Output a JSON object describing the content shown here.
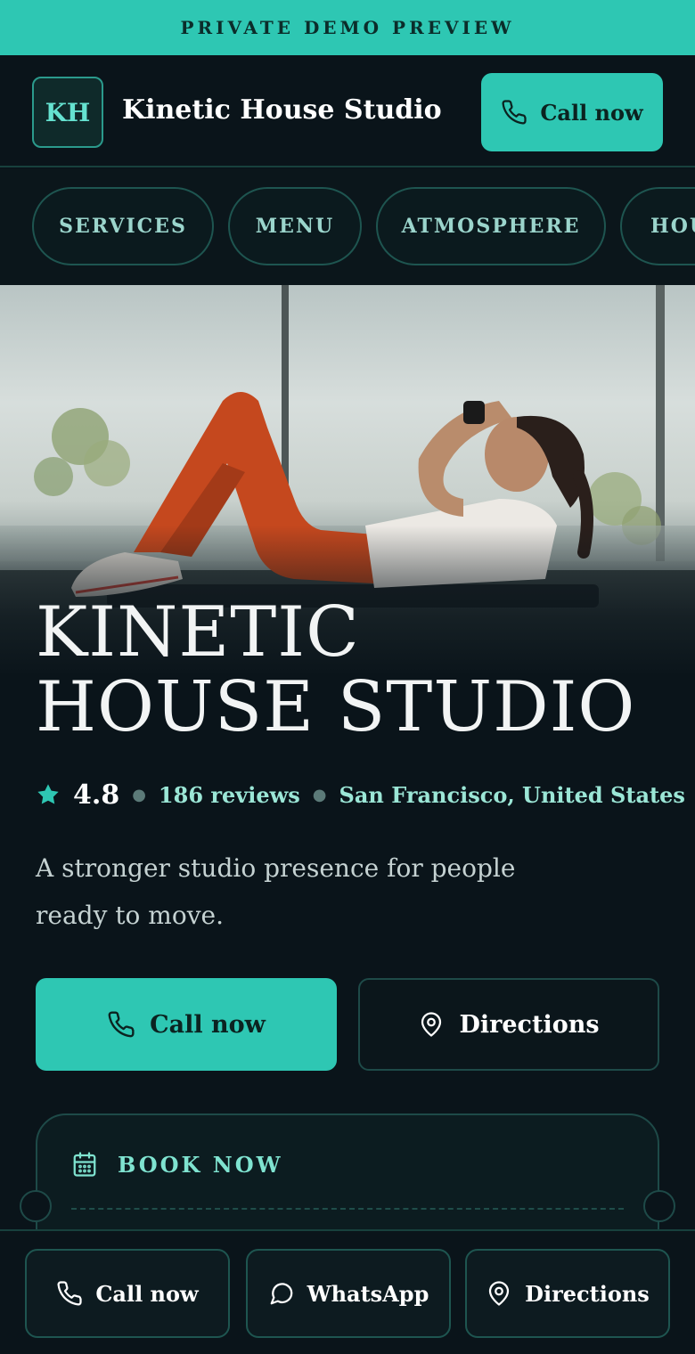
{
  "banner": {
    "text": "PRIVATE DEMO PREVIEW"
  },
  "header": {
    "logo_initials": "KH",
    "brand_name": "Kinetic House Studio",
    "call_label": "Call now"
  },
  "nav": {
    "items": [
      {
        "label": "SERVICES"
      },
      {
        "label": "MENU"
      },
      {
        "label": "ATMOSPHERE"
      },
      {
        "label": "HOU"
      }
    ]
  },
  "hero": {
    "title_line1": "KINETIC",
    "title_line2": "HOUSE STUDIO",
    "rating": "4.8",
    "reviews": "186 reviews",
    "location": "San Francisco, United States",
    "tagline": "A stronger studio presence for people ready to move."
  },
  "cta": {
    "call_label": "Call now",
    "directions_label": "Directions"
  },
  "booking": {
    "label": "BOOK NOW"
  },
  "bottom_bar": {
    "call_label": "Call now",
    "whatsapp_label": "WhatsApp",
    "directions_label": "Directions"
  },
  "colors": {
    "accent": "#2ec7b3",
    "background": "#0a141a",
    "accent_text": "#9be6d6"
  },
  "icons": [
    "phone-icon",
    "map-pin-icon",
    "star-icon",
    "calendar-icon",
    "whatsapp-icon"
  ]
}
